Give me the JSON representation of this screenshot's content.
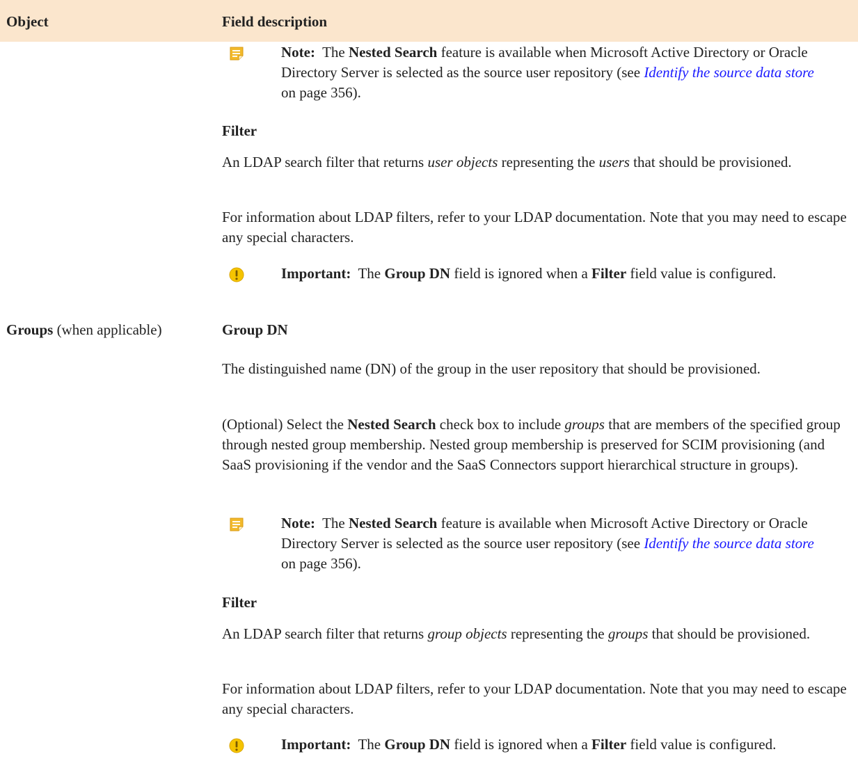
{
  "table": {
    "header": {
      "object": "Object",
      "field_description": "Field description"
    }
  },
  "users_section": {
    "note": {
      "label": "Note:",
      "pre": "The",
      "feature": "Nested Search",
      "text": "feature is available when Microsoft Active Directory or Oracle Directory Server is selected as the source user repository (see",
      "link": "Identify the source data store",
      "post": "on page 356)."
    },
    "filter_heading": "Filter",
    "filter_desc": {
      "pre": "An LDAP search filter that returns",
      "em1": "user objects",
      "mid": "representing the",
      "em2": "users",
      "post": "that should be provisioned."
    },
    "ldap_info": "For information about LDAP filters, refer to your LDAP documentation. Note that you may need to escape any special characters.",
    "important": {
      "label": "Important:",
      "pre": "The",
      "field1": "Group DN",
      "mid": "field is ignored when a",
      "field2": "Filter",
      "post": "field value is configured."
    }
  },
  "groups_section": {
    "object_label": "Groups",
    "object_suffix": "(when applicable)",
    "group_dn_heading": "Group DN",
    "group_dn_desc": "The distinguished name (DN) of the group in the user repository that should be provisioned.",
    "optional": {
      "pre": "(Optional) Select the",
      "bold": "Nested Search",
      "mid": "check box to include",
      "em": "groups",
      "post": "that are members of the specified group through nested group membership. Nested group membership is preserved for SCIM provisioning (and SaaS provisioning if the vendor and the SaaS Connectors support hierarchical structure in groups)."
    },
    "note": {
      "label": "Note:",
      "pre": "The",
      "feature": "Nested Search",
      "text": "feature is available when Microsoft Active Directory or Oracle Directory Server is selected as the source user repository (see",
      "link": "Identify the source data store",
      "post": "on page 356)."
    },
    "filter_heading": "Filter",
    "filter_desc": {
      "pre": "An LDAP search filter that returns",
      "em1": "group objects",
      "mid": "representing the",
      "em2": "groups",
      "post": "that should be provisioned."
    },
    "ldap_info": "For information about LDAP filters, refer to your LDAP documentation. Note that you may need to escape any special characters.",
    "important": {
      "label": "Important:",
      "pre": "The",
      "field1": "Group DN",
      "mid": "field is ignored when a",
      "field2": "Filter",
      "post": "field value is configured."
    }
  },
  "icons": {
    "note": "note-icon",
    "important": "important-icon",
    "note_color": "#f2b92a",
    "important_color": "#f5c400"
  }
}
